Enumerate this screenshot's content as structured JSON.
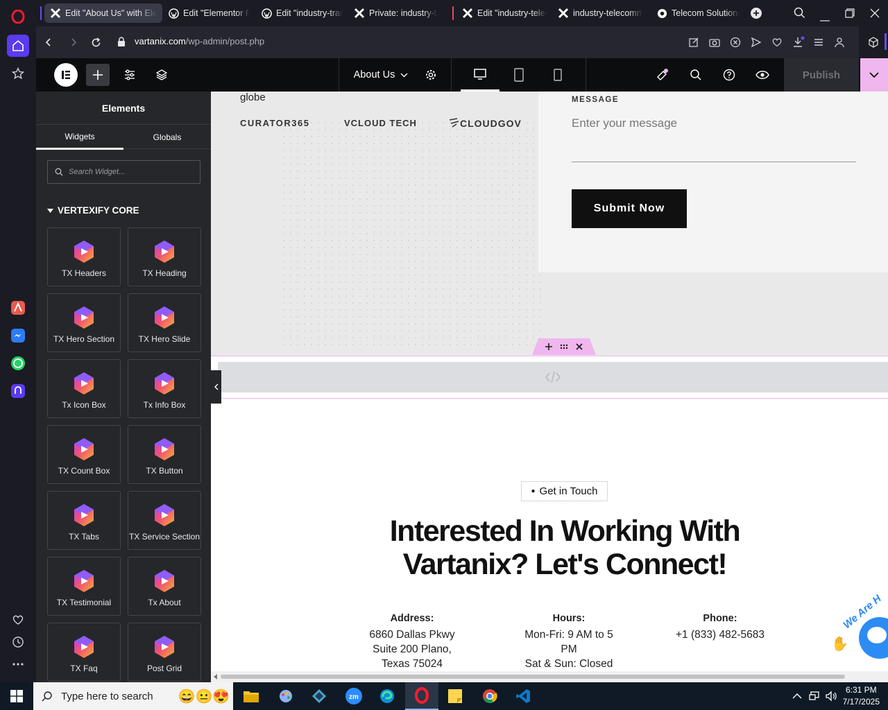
{
  "browser": {
    "tabs": [
      {
        "label": "Edit \"About Us\" with Elementor",
        "icon": "elementor-x-icon",
        "active": true
      },
      {
        "label": "Edit \"Elementor Page\"",
        "icon": "wordpress-icon",
        "active": false
      },
      {
        "label": "Edit \"industry-transport\"",
        "icon": "wordpress-icon",
        "active": false
      },
      {
        "label": "Private: industry-transport",
        "icon": "elementor-x-icon",
        "active": false
      },
      {
        "label": "Edit \"industry-telecom\"",
        "icon": "elementor-x-icon",
        "active": false
      },
      {
        "label": "industry-telecommunications",
        "icon": "elementor-x-icon",
        "active": false
      },
      {
        "label": "Telecom Solutions -",
        "icon": "site-icon",
        "active": false
      }
    ],
    "url_host": "vartanix.com",
    "url_path": "/wp-admin/post.php"
  },
  "editor": {
    "page_name": "About Us",
    "publish_label": "Publish"
  },
  "panel": {
    "title": "Elements",
    "tabs": [
      "Widgets",
      "Globals"
    ],
    "search_placeholder": "Search Widget...",
    "category": "VERTEXIFY CORE",
    "widgets": [
      "TX Headers",
      "TX Heading",
      "TX Hero Section",
      "TX Hero Slide",
      "Tx Icon Box",
      "Tx Info Box",
      "TX Count Box",
      "TX Button",
      "TX Tabs",
      "TX Service Section",
      "TX Testimonial",
      "Tx About",
      "TX Faq",
      "Post Grid"
    ]
  },
  "canvas": {
    "globe_text": "globe",
    "logos": [
      "CURATOR365",
      "VCLOUD TECH",
      "CLOUDGOV"
    ],
    "message_label": "MESSAGE",
    "message_placeholder": "Enter your message",
    "submit_label": "Submit Now",
    "badge": "Get in Touch",
    "headline_line1": "Interested In Working With",
    "headline_line2": "Vartanix? Let's Connect!",
    "address": {
      "title": "Address:",
      "lines": [
        "6860 Dallas Pkwy",
        "Suite 200 Plano,",
        "Texas 75024"
      ]
    },
    "hours": {
      "title": "Hours:",
      "lines": [
        "Mon-Fri: 9 AM to 5",
        "PM",
        "Sat & Sun: Closed"
      ]
    },
    "phone": {
      "title": "Phone:",
      "lines": [
        "+1 (833) 482-5683"
      ]
    },
    "we_are_text": "We Are H"
  },
  "taskbar": {
    "search_placeholder": "Type here to search",
    "time": "6:31 PM",
    "date": "7/17/2025"
  },
  "colors": {
    "accent_pink": "#f0b6ee",
    "panel_bg": "#26272b",
    "topbar_bg": "#0c0d0e",
    "opera_red": "#ff1b2d",
    "messenger_blue": "#2c7cf6",
    "whatsapp_green": "#25d366"
  }
}
